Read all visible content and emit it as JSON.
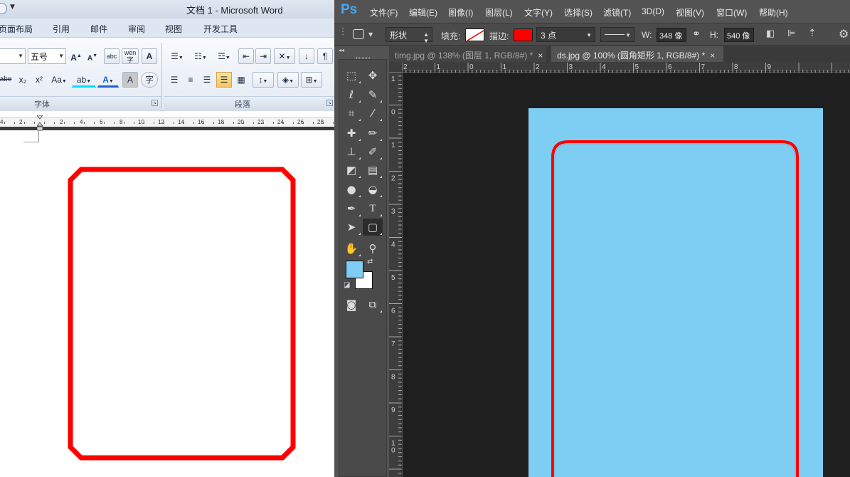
{
  "word": {
    "title": "文档 1 - Microsoft Word",
    "tabs": [
      "页面布局",
      "引用",
      "邮件",
      "审阅",
      "视图",
      "开发工具"
    ],
    "font_size": "五号",
    "group_font": "字体",
    "group_paragraph": "段落",
    "ruler_numbers": [
      "4",
      "2",
      "2",
      "4",
      "6",
      "8",
      "10",
      "12",
      "14",
      "16",
      "18",
      "20",
      "22",
      "24",
      "26",
      "28"
    ],
    "buttons": {
      "grow_font": "A",
      "shrink_font": "A",
      "clear_format": "abc",
      "phonetic": "wén",
      "char_border": "A",
      "strikethrough": "abe",
      "subscript": "x₂",
      "superscript": "x²",
      "change_case": "Aa",
      "highlight": "ab",
      "font_color": "A",
      "char_shading": "A",
      "enclose": "字"
    },
    "shape_color": "#ff0000"
  },
  "photoshop": {
    "logo": "Ps",
    "menus": [
      "文件(F)",
      "编辑(E)",
      "图像(I)",
      "图层(L)",
      "文字(Y)",
      "选择(S)",
      "滤镜(T)",
      "3D(D)",
      "视图(V)",
      "窗口(W)",
      "帮助(H)"
    ],
    "options": {
      "mode": "形状",
      "fill_label": "填充:",
      "stroke_label": "描边:",
      "stroke_color": "#ff0000",
      "stroke_width": "3 点",
      "w_label": "W:",
      "w_value": "348 像",
      "h_label": "H:",
      "h_value": "540 像"
    },
    "doc_tabs": [
      {
        "label": "timg.jpg @ 138% (图层 1, RGB/8#) *",
        "close": "×"
      },
      {
        "label": "ds.jpg @ 100% (圆角矩形 1, RGB/8#) *",
        "close": "×"
      }
    ],
    "ruler_top_numbers": [
      "2",
      "1",
      "0",
      "1",
      "2",
      "3",
      "4",
      "5",
      "6",
      "7",
      "8",
      "9"
    ],
    "ruler_left_numbers": [
      "1",
      "0",
      "1",
      "2",
      "3",
      "4",
      "5",
      "6",
      "7",
      "8",
      "9",
      "1\n0"
    ],
    "foreground_color": "#7ecef4",
    "background_color": "#ffffff",
    "canvas_color": "#7ecef4",
    "shape_stroke_color": "#ff0000"
  }
}
